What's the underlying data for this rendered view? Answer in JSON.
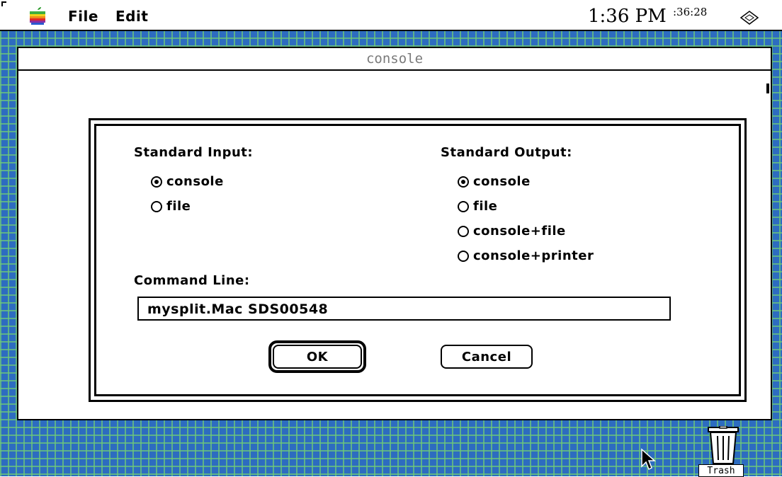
{
  "menubar": {
    "apple_icon": "apple-icon",
    "items": [
      {
        "label": "File"
      },
      {
        "label": "Edit"
      }
    ],
    "clock": "1:36 PM",
    "clock_seconds": ":36:28",
    "notify_icon": "notification-icon"
  },
  "window": {
    "title": "console"
  },
  "dialog": {
    "standard_input": {
      "label": "Standard Input:",
      "options": [
        {
          "label": "console",
          "selected": true
        },
        {
          "label": "file",
          "selected": false
        }
      ]
    },
    "standard_output": {
      "label": "Standard Output:",
      "options": [
        {
          "label": "console",
          "selected": true
        },
        {
          "label": "file",
          "selected": false
        },
        {
          "label": "console+file",
          "selected": false
        },
        {
          "label": "console+printer",
          "selected": false
        }
      ]
    },
    "command_line": {
      "label": "Command Line:",
      "value": "mysplit.Mac SDS00548"
    },
    "ok_label": "OK",
    "cancel_label": "Cancel"
  },
  "desktop": {
    "trash_label": "Trash",
    "pattern_colors": {
      "base": "#2d6cc0",
      "grid": "#6ec878"
    }
  }
}
